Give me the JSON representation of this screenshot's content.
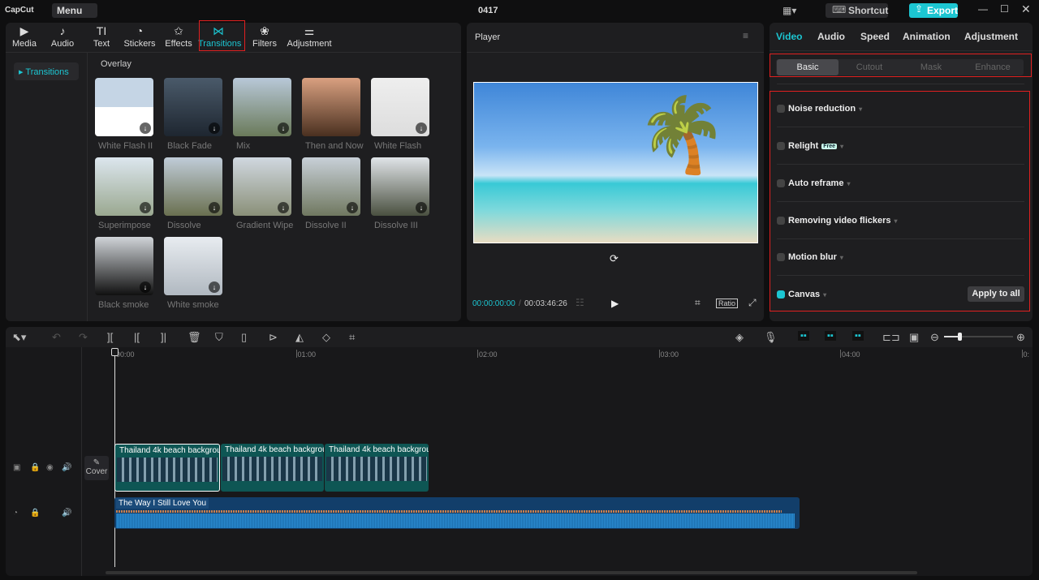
{
  "app": {
    "logo": "CapCut",
    "menu": "Menu",
    "project_title": "0417",
    "shortcut": "Shortcut",
    "export": "Export"
  },
  "toolbar": [
    {
      "label": "Media",
      "icon": "▶"
    },
    {
      "label": "Audio",
      "icon": "♪"
    },
    {
      "label": "Text",
      "icon": "TI"
    },
    {
      "label": "Stickers",
      "icon": "◔"
    },
    {
      "label": "Effects",
      "icon": "✩"
    },
    {
      "label": "Transitions",
      "icon": "⋈"
    },
    {
      "label": "Filters",
      "icon": "❀"
    },
    {
      "label": "Adjustment",
      "icon": "⚌"
    }
  ],
  "sidebar": {
    "item": "Transitions"
  },
  "library": {
    "section": "Overlay",
    "items": [
      "White Flash II",
      "Black Fade",
      "Mix",
      "Then and Now",
      "White Flash",
      "Superimpose",
      "Dissolve",
      "Gradient Wipe",
      "Dissolve II",
      "Dissolve III",
      "Black smoke",
      "White smoke"
    ]
  },
  "player": {
    "title": "Player",
    "current_time": "00:00:00:00",
    "total_time": "00:03:46:26",
    "ratio": "Ratio"
  },
  "inspector": {
    "tabs": [
      "Video",
      "Audio",
      "Speed",
      "Animation",
      "Adjustment"
    ],
    "subtabs": [
      "Basic",
      "Cutout",
      "Mask",
      "Enhance"
    ],
    "options": [
      {
        "label": "Noise reduction",
        "checked": false
      },
      {
        "label": "Relight",
        "badge": "Free",
        "checked": false
      },
      {
        "label": "Auto reframe",
        "checked": false
      },
      {
        "label": "Removing video flickers",
        "checked": false
      },
      {
        "label": "Motion blur",
        "checked": false
      },
      {
        "label": "Canvas",
        "checked": true
      }
    ],
    "apply_all": "Apply to all"
  },
  "timeline": {
    "ticks": [
      "00:00",
      "01:00",
      "02:00",
      "03:00",
      "04:00",
      "0:"
    ],
    "cover": "Cover",
    "video_clips": [
      "Thailand 4k beach backgrou",
      "Thailand 4k beach backgrou",
      "Thailand 4k beach backgrou"
    ],
    "audio_clip": "The Way I Still Love You",
    "zoom_level": 0.2
  },
  "colors": {
    "accent": "#1cc6d2",
    "highlight": "#e02020"
  }
}
